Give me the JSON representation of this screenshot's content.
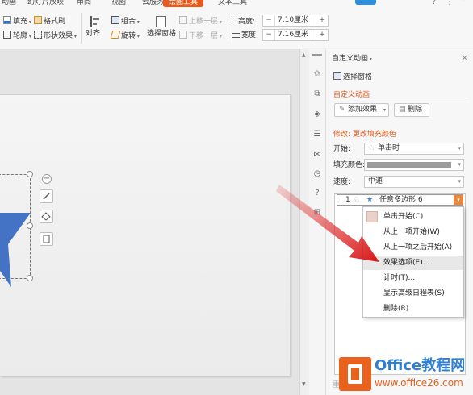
{
  "tabs": [
    "动画",
    "幻灯片放映",
    "审阅",
    "视图",
    "云服务",
    "绘图工具",
    "文本工具"
  ],
  "ribbon": {
    "fill_label": "填充",
    "format_painter_label": "格式刷",
    "outline_label": "轮廓",
    "shape_effect_label": "形状效果",
    "align_label": "对齐",
    "group_label": "组合",
    "rotate_label": "旋转",
    "selection_pane_label": "选择窗格",
    "bring_forward_label": "上移一层",
    "send_backward_label": "下移一层",
    "height_label": "高度:",
    "height_value": "7.10厘米",
    "width_label": "宽度:",
    "width_value": "7.16厘米",
    "minus": "−",
    "plus": "+"
  },
  "pane": {
    "title": "自定义动画",
    "selection_pane": "选择窗格",
    "section_title": "自定义动画",
    "add_effect": "添加效果",
    "delete": "删除",
    "modify_title": "修改: 更改填充颜色",
    "start_label": "开始:",
    "start_value": "单击时",
    "fill_color_label": "填充颜色:",
    "speed_label": "速度:",
    "speed_value": "中速",
    "list_item_index": "1",
    "list_item_label": "任意多边形 6",
    "reorder_label": "重新"
  },
  "context_menu": [
    {
      "label": "单击开始(C)"
    },
    {
      "label": "从上一项开始(W)"
    },
    {
      "label": "从上一项之后开始(A)"
    },
    {
      "label": "效果选项(E)..."
    },
    {
      "label": "计时(T)..."
    },
    {
      "label": "显示高级日程表(S)"
    },
    {
      "label": "删除(R)"
    }
  ],
  "watermark": {
    "brand": "Office教程网",
    "url": "www.office26.com"
  },
  "colors": {
    "accent": "#e85a1b",
    "shape_blue": "#4472c4",
    "arrow_red": "#e02020"
  }
}
